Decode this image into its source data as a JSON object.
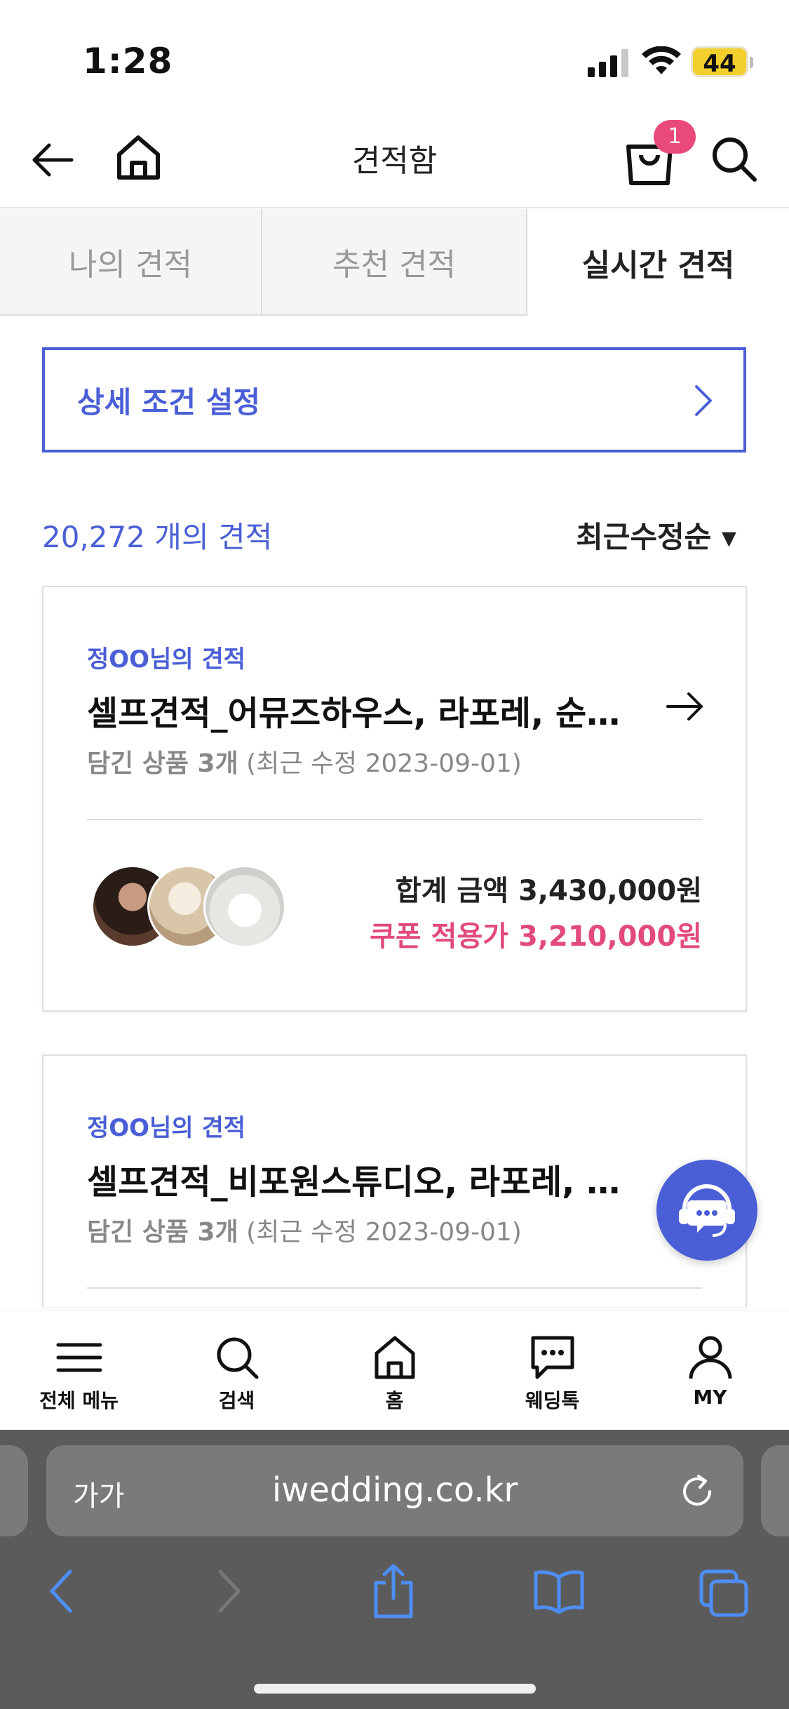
{
  "status_bar": {
    "time": "1:28",
    "battery": "44"
  },
  "header": {
    "title": "견적함",
    "cart_count": "1"
  },
  "tabs": [
    {
      "label": "나의 견적",
      "active": false
    },
    {
      "label": "추천 견적",
      "active": false
    },
    {
      "label": "실시간 견적",
      "active": true
    }
  ],
  "detail_settings": {
    "label": "상세 조건 설정"
  },
  "list": {
    "count_label": "20,272 개의 견적",
    "sort_label": "최근수정순 ▾"
  },
  "cards": [
    {
      "owner": "정OO님의 견적",
      "title": "셀프견적_어뮤즈하우스, 라포레, 순…",
      "items_label": "담긴 상품 3개",
      "modified": "(최근 수정 2023-09-01)",
      "total_label": "합계 금액 3,430,000원",
      "coupon_label": "쿠폰 적용가 3,210,000원"
    },
    {
      "owner": "정OO님의 견적",
      "title": "셀프견적_비포원스튜디오, 라포레, …",
      "items_label": "담긴 상품 3개",
      "modified": "(최근 수정 2023-09-01)"
    }
  ],
  "bottom_nav": [
    {
      "label": "전체 메뉴",
      "icon": "menu-icon"
    },
    {
      "label": "검색",
      "icon": "search-icon"
    },
    {
      "label": "홈",
      "icon": "home-icon"
    },
    {
      "label": "웨딩톡",
      "icon": "chat-icon"
    },
    {
      "label": "MY",
      "icon": "user-icon"
    }
  ],
  "browser": {
    "text_size_label": "가가",
    "url": "iwedding.co.kr"
  },
  "colors": {
    "accent": "#4a5fd6",
    "coupon": "#e24a7d",
    "badge": "#ea4a7a",
    "browser_bar": "#5b5b5b"
  }
}
